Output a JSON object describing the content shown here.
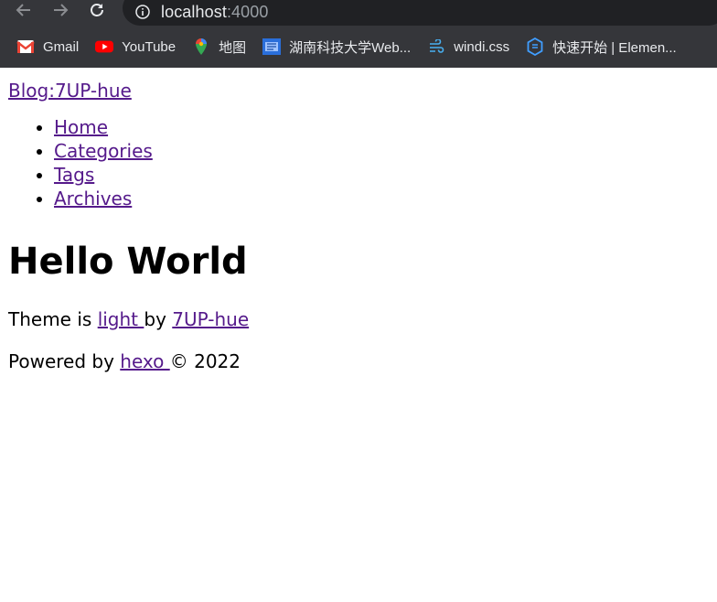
{
  "browser": {
    "url_host": "localhost",
    "url_port": ":4000",
    "bookmarks": [
      {
        "label": "Gmail",
        "icon": "gmail-icon"
      },
      {
        "label": "YouTube",
        "icon": "youtube-icon"
      },
      {
        "label": "地图",
        "icon": "maps-icon"
      },
      {
        "label": "湖南科技大学Web...",
        "icon": "university-icon"
      },
      {
        "label": "windi.css",
        "icon": "windi-icon"
      },
      {
        "label": "快速开始 | Elemen...",
        "icon": "element-icon"
      }
    ]
  },
  "site": {
    "blog_title": "Blog:7UP-hue",
    "menu": [
      "Home",
      "Categories",
      "Tags",
      "Archives"
    ]
  },
  "post": {
    "title": "Hello World"
  },
  "footer": {
    "theme_prefix": "Theme is ",
    "theme_name": "light ",
    "theme_by": "by ",
    "author": "7UP-hue",
    "powered_prefix": "Powered by ",
    "powered_name": "hexo ",
    "copyright": "© 2022"
  },
  "colors": {
    "chrome_bg": "#35363a",
    "omnibox_bg": "#202124",
    "link": "#551a8b"
  }
}
